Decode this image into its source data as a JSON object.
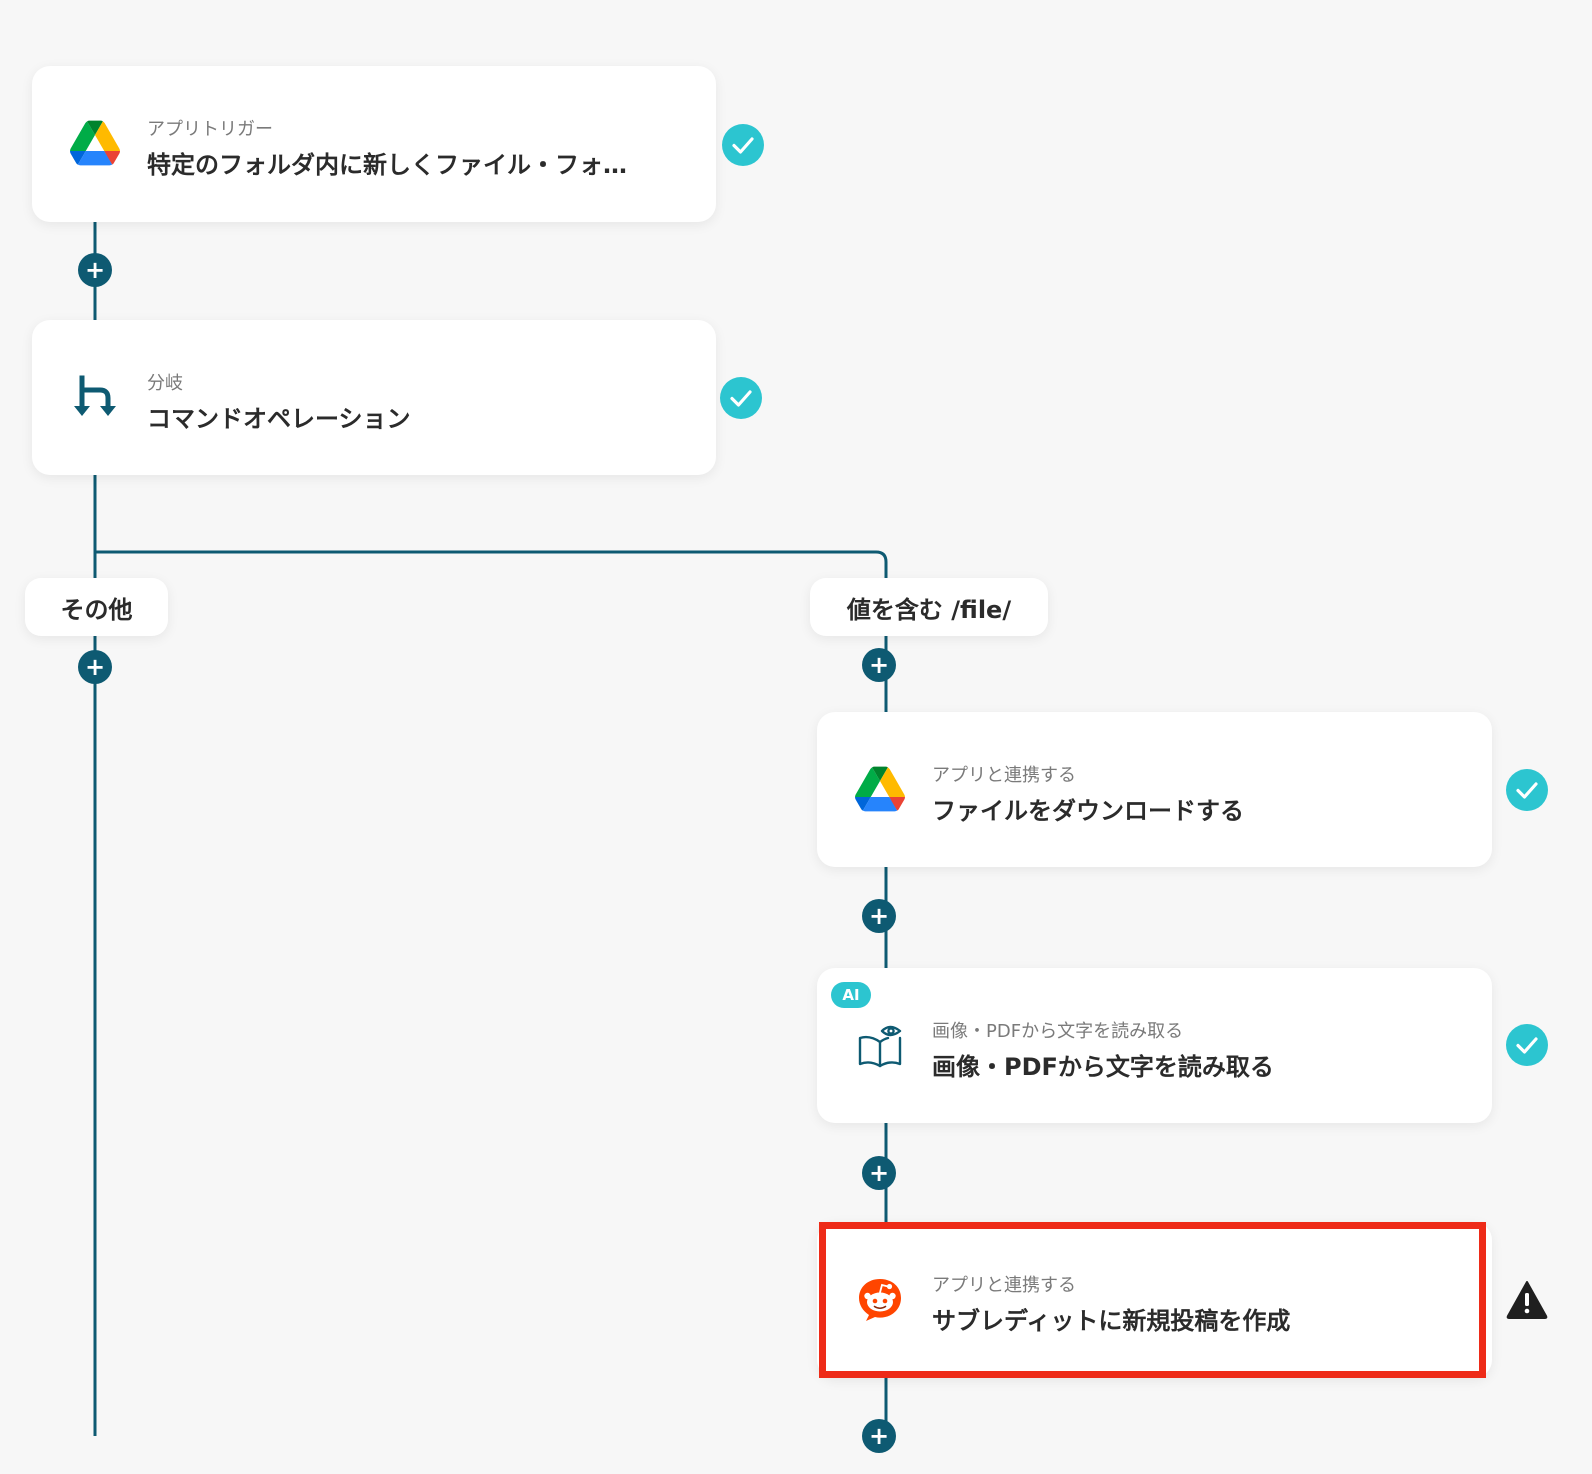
{
  "steps": [
    {
      "sub": "アプリトリガー",
      "main": "特定のフォルダ内に新しくファイル・フォ…",
      "icon": "google-drive-icon",
      "status": "success"
    },
    {
      "sub": "分岐",
      "main": "コマンドオペレーション",
      "icon": "branch-icon",
      "status": "success"
    },
    {
      "sub": "アプリと連携する",
      "main": "ファイルをダウンロードする",
      "icon": "google-drive-icon",
      "status": "success"
    },
    {
      "sub": "画像・PDFから文字を読み取る",
      "main": "画像・PDFから文字を読み取る",
      "icon": "ocr-book-icon",
      "status": "success",
      "badge": "AI"
    },
    {
      "sub": "アプリと連携する",
      "main": "サブレディットに新規投稿を作成",
      "icon": "reddit-icon",
      "status": "warning"
    }
  ],
  "branches": {
    "other": "その他",
    "contains": "値を含む /file/"
  },
  "add_button_glyph": "+",
  "colors": {
    "line": "#0e5a72",
    "success": "#2cc5d0",
    "warning": "#1f1f1f",
    "highlight": "#ee2b18"
  }
}
